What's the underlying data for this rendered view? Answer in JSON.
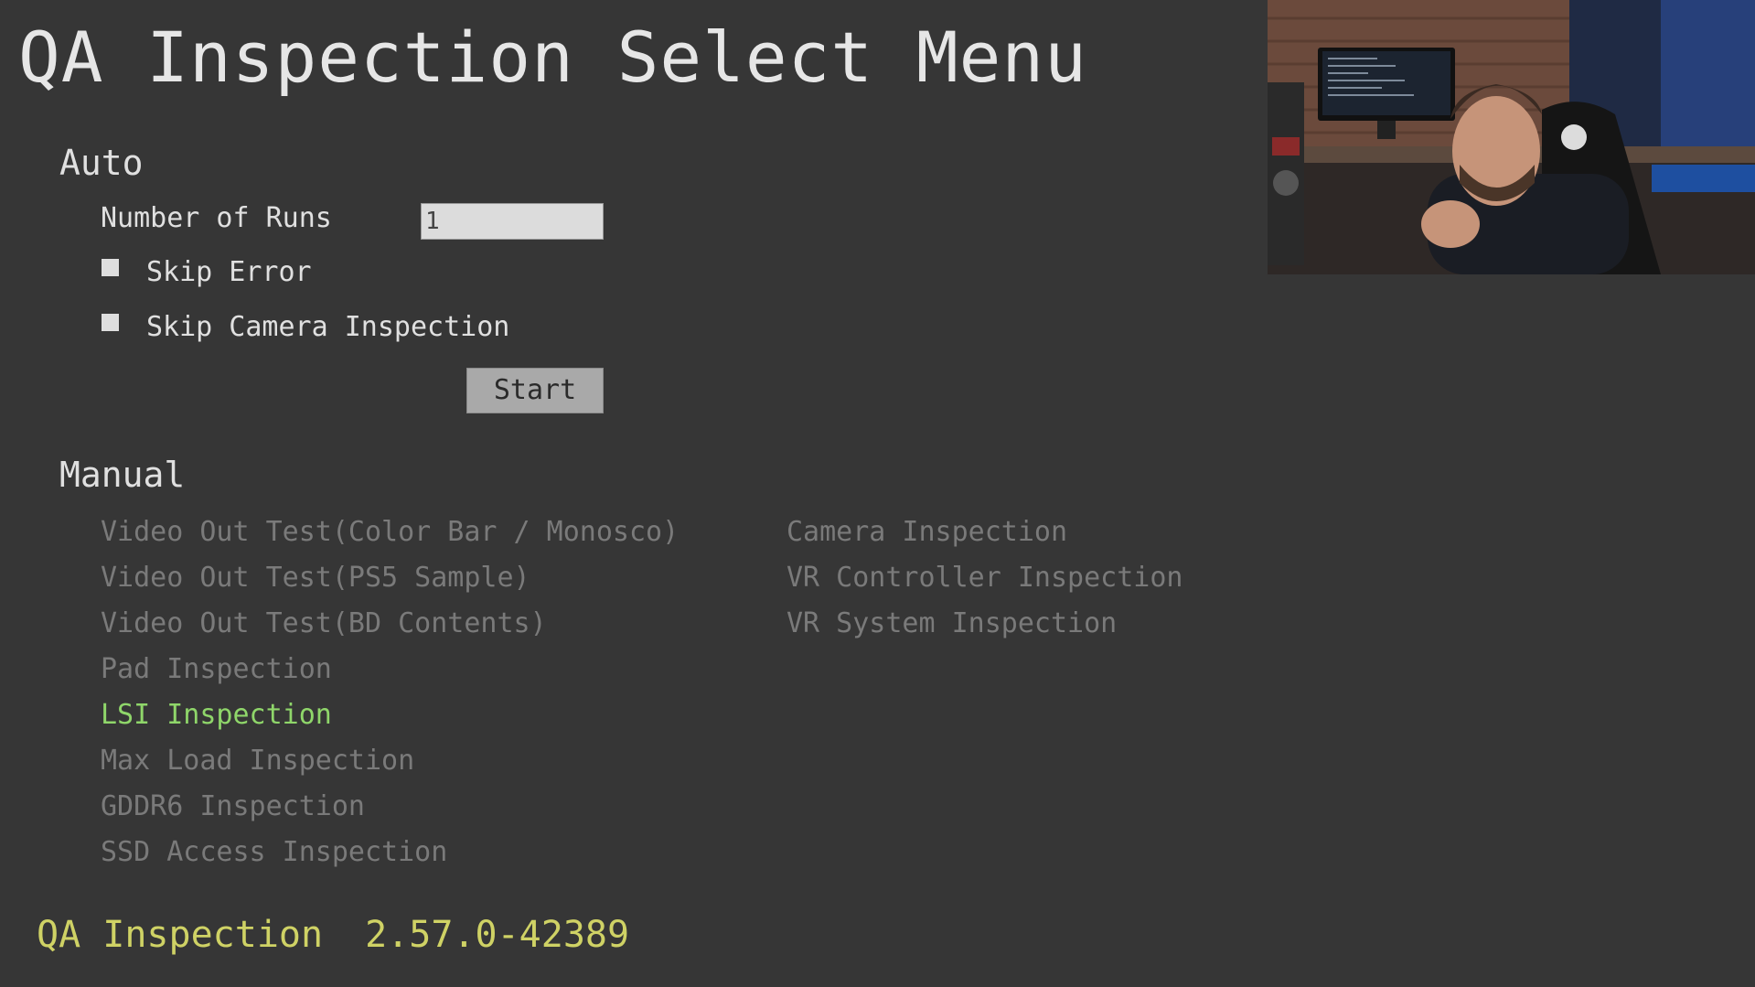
{
  "page": {
    "title": "QA Inspection Select Menu"
  },
  "auto": {
    "heading": "Auto",
    "runs_label": "Number of Runs",
    "runs_value": "1",
    "skip_error_label": "Skip Error",
    "skip_error_checked": false,
    "skip_camera_label": "Skip Camera Inspection",
    "skip_camera_checked": false,
    "start_label": "Start"
  },
  "manual": {
    "heading": "Manual",
    "left_items": [
      "Video Out Test(Color Bar / Monosco)",
      "Video Out Test(PS5 Sample)",
      "Video Out Test(BD Contents)",
      "Pad Inspection",
      "LSI Inspection",
      "Max Load Inspection",
      "GDDR6 Inspection",
      "SSD Access Inspection"
    ],
    "right_items": [
      "Camera Inspection",
      "VR Controller Inspection",
      "VR System Inspection"
    ],
    "selected_item": "LSI Inspection"
  },
  "footer": {
    "app_name": "QA Inspection",
    "version": "2.57.0-42389"
  },
  "colors": {
    "background": "#363636",
    "selected_item": "#8fd66a",
    "inactive_item": "#7a7a7a",
    "footer_text": "#cfd265"
  }
}
